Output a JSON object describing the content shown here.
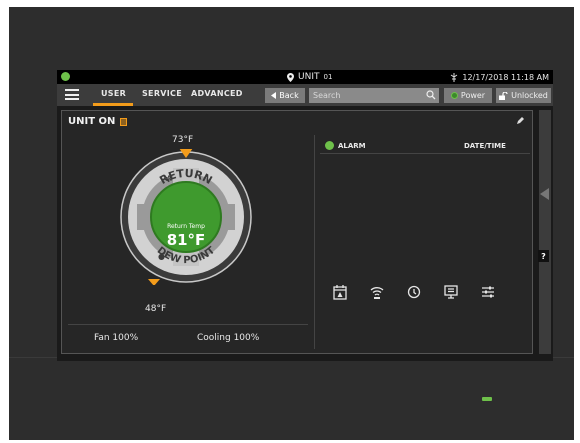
{
  "statusbar": {
    "unit_title": "UNIT",
    "unit_number": "01",
    "datetime": "12/17/2018 11:18 AM"
  },
  "nav": {
    "tabs": [
      {
        "label": "USER"
      },
      {
        "label": "SERVICE"
      },
      {
        "label": "ADVANCED"
      }
    ],
    "back_label": "Back",
    "search_placeholder": "Search",
    "power_label": "Power",
    "unlocked_label": "Unlocked"
  },
  "panel": {
    "title": "UNIT ON"
  },
  "gauge": {
    "top_temp": "73°F",
    "bottom_temp": "48°F",
    "ring_top_label": "RETURN",
    "ring_bottom_label": "DEW POINT",
    "center_label": "Return Temp",
    "center_value": "81°F"
  },
  "status": {
    "fan": "Fan 100%",
    "cooling": "Cooling 100%"
  },
  "alarms": {
    "alarm_header": "ALARM",
    "datetime_header": "DATE/TIME"
  },
  "help": {
    "label": "?"
  },
  "colors": {
    "accent": "#f39c1b",
    "ok_green": "#6ec04a",
    "gauge_green": "#3f9a2e"
  },
  "icons": [
    "location-pin-icon",
    "network-icon",
    "hamburger-icon",
    "search-icon",
    "power-icon",
    "unlock-icon",
    "pencil-icon",
    "calendar-alarm-icon",
    "wireless-icon",
    "history-icon",
    "display-icon",
    "sliders-icon"
  ]
}
